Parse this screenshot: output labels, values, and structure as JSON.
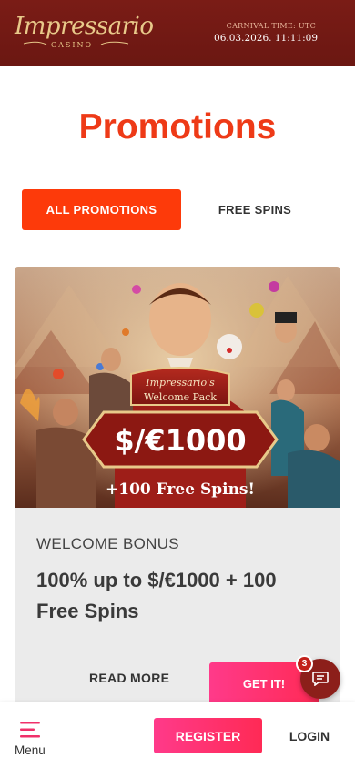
{
  "header": {
    "logo_text": "Impressario",
    "logo_sub": "CASINO",
    "carnival_label": "CARNIVAL TIME: UTC",
    "carnival_time": "06.03.2026. 11:11:09"
  },
  "page": {
    "title": "Promotions"
  },
  "tabs": [
    {
      "label": "ALL PROMOTIONS",
      "active": true
    },
    {
      "label": "FREE SPINS",
      "active": false
    }
  ],
  "promo": {
    "image": {
      "name": "Impressario's",
      "pack": "Welcome Pack",
      "amount": "$/€1000",
      "spins": "+100 Free Spins!"
    },
    "category": "WELCOME BONUS",
    "title": "100% up to $/€1000 + 100 Free Spins",
    "read_more_label": "READ MORE",
    "cta_label": "GET IT!"
  },
  "chat": {
    "badge_count": "3",
    "icon": "chat-icon"
  },
  "bottom_bar": {
    "menu_label": "Menu",
    "menu_icon": "hamburger-menu-icon",
    "register_label": "REGISTER",
    "login_label": "LOGIN"
  },
  "colors": {
    "header_bg": "#7a1c16",
    "accent": "#fd3a0a",
    "title": "#ee3a17",
    "cta_pink": "#ff2a6a",
    "chat_bg": "#8c1f1a"
  }
}
